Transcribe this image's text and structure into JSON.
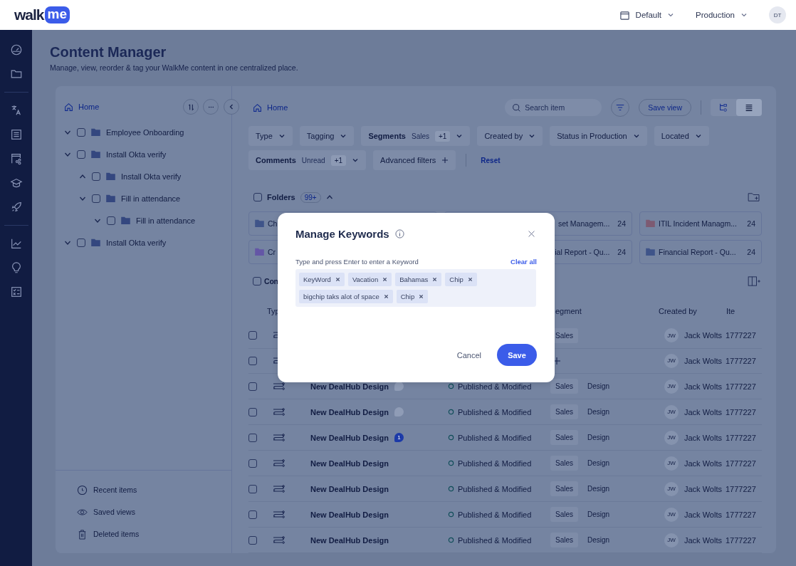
{
  "header": {
    "logo": {
      "part_1": "walk",
      "part_2": "me"
    },
    "environment": "Default",
    "system": "Production",
    "avatar": "DT"
  },
  "page": {
    "title": "Content Manager",
    "subtitle": "Manage, view, reorder & tag your WalkMe content in one centralized place."
  },
  "tree": {
    "home": "Home",
    "items": [
      {
        "label": "Employee Onboarding",
        "expanded": true,
        "checked": false
      },
      {
        "label": "Install Okta verify",
        "expanded": true,
        "checked": false,
        "children": [
          {
            "label": "Install Okta verify",
            "expanded": false,
            "checked": false
          },
          {
            "label": "Fill in attendance",
            "expanded": true,
            "checked": false,
            "children": [
              {
                "label": "Fill in attendance",
                "expanded": true,
                "checked": false
              }
            ]
          }
        ]
      },
      {
        "label": "Install Okta verify",
        "expanded": true,
        "checked": false
      }
    ]
  },
  "bottom_links": [
    {
      "label": "Recent items",
      "kind": "recent"
    },
    {
      "label": "Saved views",
      "kind": "views"
    },
    {
      "label": "Deleted items",
      "kind": "deleted"
    }
  ],
  "content": {
    "breadcrumb": "Home",
    "search": {
      "placeholder": "Search item"
    },
    "save_view": "Save view",
    "views": [
      {
        "kind": "tree",
        "selected": false
      },
      {
        "kind": "list",
        "selected": true
      }
    ],
    "filter_rows": [
      [
        {
          "label": "Type",
          "kind": "dropdown"
        },
        {
          "label": "Tagging",
          "kind": "dropdown"
        },
        {
          "label": "Segments",
          "value": "Sales",
          "extra": "+1",
          "kind": "dropdown"
        },
        {
          "label": "Created by",
          "kind": "dropdown"
        },
        {
          "label": "Status in Production",
          "kind": "dropdown"
        },
        {
          "label": "Located",
          "kind": "dropdown"
        }
      ],
      [
        {
          "label": "Comments",
          "value": "Unread",
          "extra": "+1",
          "kind": "dropdown"
        },
        {
          "label": "Advanced filters",
          "kind": "add"
        }
      ]
    ],
    "reset": "Reset"
  },
  "folders": {
    "label": "Folders",
    "count": "99+",
    "expanded": true,
    "checked": false,
    "items": [
      {
        "name": "Ch",
        "color": "#3f5489"
      },
      {
        "name": "set Managem...",
        "count": "24"
      },
      {
        "name": "ITIL Incident Managm...",
        "count": "24",
        "color": "#7d5a72"
      },
      {
        "name": "Cr",
        "color": "#6456a6"
      },
      {
        "name": "ial Report - Qu...",
        "count": "24"
      },
      {
        "name": "Financial Report - Qu...",
        "count": "24",
        "color": "#3f5489"
      }
    ]
  },
  "content_section": {
    "label": "Con",
    "checked": false
  },
  "table": {
    "columns": {
      "type": "Typ",
      "segment": "egment",
      "created_by": "Created by",
      "id": "Ite"
    },
    "rows": [
      {
        "checked": false,
        "segments": [
          "Sales"
        ],
        "initials": "JW",
        "creator": "Jack Wolts",
        "id": "1777227"
      },
      {
        "checked": false,
        "segment_add": true,
        "initials": "JW",
        "creator": "Jack Wolts",
        "id": "1777227"
      },
      {
        "checked": false,
        "name": "New DealHub Design",
        "comments_unread": false,
        "status": "Published & Modified",
        "segments": [
          "Sales",
          "Design"
        ],
        "initials": "JW",
        "creator": "Jack Wolts",
        "id": "1777227"
      },
      {
        "checked": false,
        "name": "New DealHub Design",
        "comments_unread": false,
        "status": "Published & Modified",
        "segments": [
          "Sales",
          "Design"
        ],
        "initials": "JW",
        "creator": "Jack Wolts",
        "id": "1777227"
      },
      {
        "checked": false,
        "name": "New DealHub Design",
        "comments_unread": true,
        "comment_count": "1",
        "status": "Published & Modified",
        "segments": [
          "Sales",
          "Design"
        ],
        "initials": "JW",
        "creator": "Jack Wolts",
        "id": "1777227"
      },
      {
        "checked": false,
        "name": "New DealHub Design",
        "status": "Published & Modified",
        "segments": [
          "Sales",
          "Design"
        ],
        "initials": "JW",
        "creator": "Jack Wolts",
        "id": "1777227"
      },
      {
        "checked": false,
        "name": "New DealHub Design",
        "status": "Published & Modified",
        "segments": [
          "Sales",
          "Design"
        ],
        "initials": "JW",
        "creator": "Jack Wolts",
        "id": "1777227"
      },
      {
        "checked": false,
        "name": "New DealHub Design",
        "status": "Published & Modified",
        "segments": [
          "Sales",
          "Design"
        ],
        "initials": "JW",
        "creator": "Jack Wolts",
        "id": "1777227"
      },
      {
        "checked": false,
        "name": "New DealHub Design",
        "status": "Published & Modified",
        "segments": [
          "Sales",
          "Design"
        ],
        "initials": "JW",
        "creator": "Jack Wolts",
        "id": "1777227"
      }
    ]
  },
  "modal": {
    "title": "Manage Keywords",
    "label": "Type and press Enter to enter a Keyword",
    "clear_all": "Clear all",
    "keywords": [
      "KeyWord",
      "Vacation",
      "Bahamas",
      "Chip",
      "bigchip taks alot of space",
      "Chip"
    ],
    "cancel": "Cancel",
    "save": "Save"
  }
}
